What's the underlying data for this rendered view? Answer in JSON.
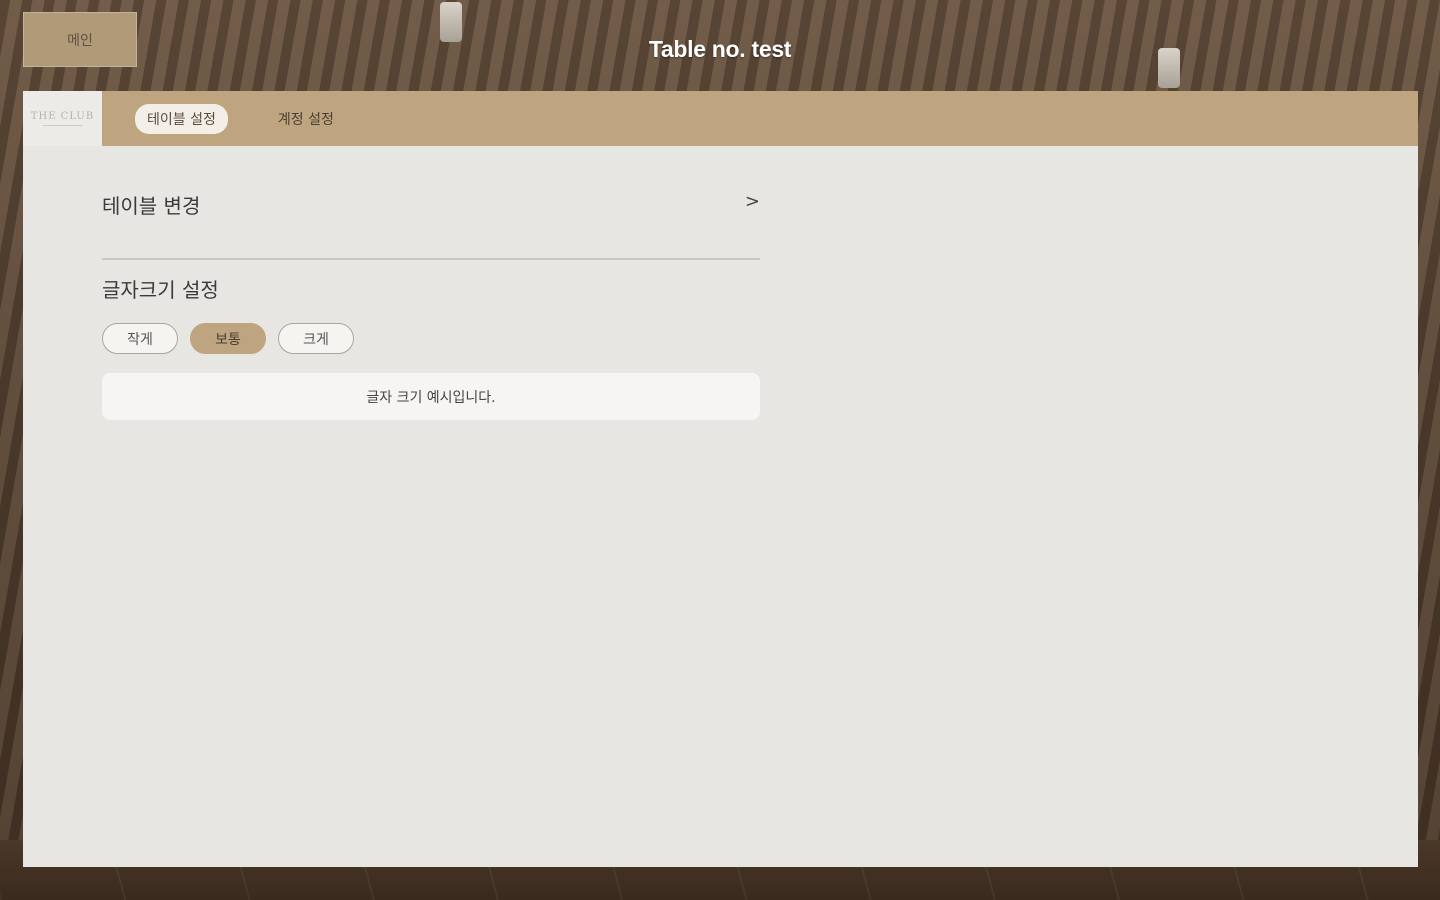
{
  "header": {
    "back_label": "메인",
    "title": "Table no. test"
  },
  "logo": {
    "text": "THE CLUB"
  },
  "tabs": [
    {
      "label": "테이블 설정",
      "active": true
    },
    {
      "label": "계정 설정",
      "active": false
    }
  ],
  "table_settings": {
    "change_table_label": "테이블 변경",
    "chevron": ">",
    "font_size_title": "글자크기 설정",
    "font_size_options": [
      {
        "label": "작게",
        "selected": false
      },
      {
        "label": "보통",
        "selected": true
      },
      {
        "label": "크게",
        "selected": false
      }
    ],
    "preview_text": "글자 크기 예시입니다."
  },
  "colors": {
    "accent": "#bea580",
    "panel_bg": "#e8e6e2",
    "preview_bg": "#f6f5f3"
  }
}
